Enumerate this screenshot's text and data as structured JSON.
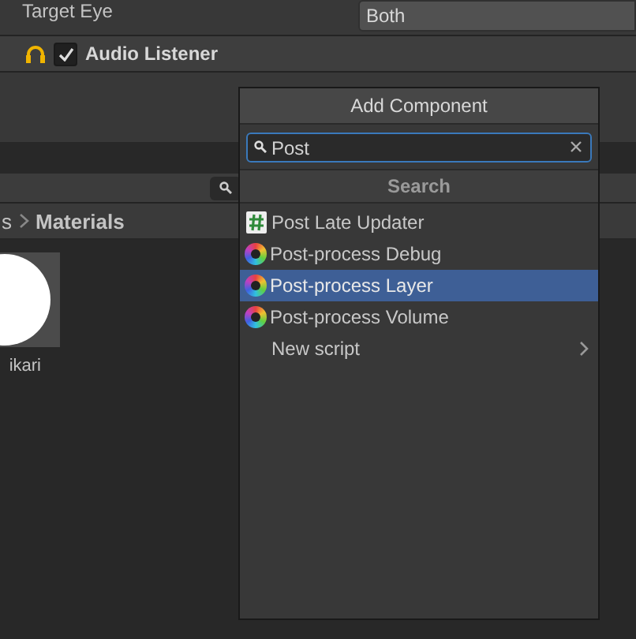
{
  "inspector": {
    "target_eye": {
      "label": "Target Eye",
      "value": "Both"
    },
    "component": {
      "name": "Audio Listener",
      "enabled": true
    }
  },
  "project": {
    "breadcrumb": [
      "s",
      "Materials"
    ],
    "assets": [
      {
        "name": "ikari"
      }
    ]
  },
  "add_component": {
    "title": "Add Component",
    "search": {
      "value": "Post"
    },
    "section": "Search",
    "items": [
      {
        "label": "Post Late Updater",
        "kind": "script",
        "selected": false
      },
      {
        "label": "Post-process Debug",
        "kind": "aperture",
        "selected": false
      },
      {
        "label": "Post-process Layer",
        "kind": "aperture",
        "selected": true
      },
      {
        "label": "Post-process Volume",
        "kind": "aperture",
        "selected": false
      },
      {
        "label": "New script",
        "kind": "submenu",
        "selected": false
      }
    ]
  }
}
